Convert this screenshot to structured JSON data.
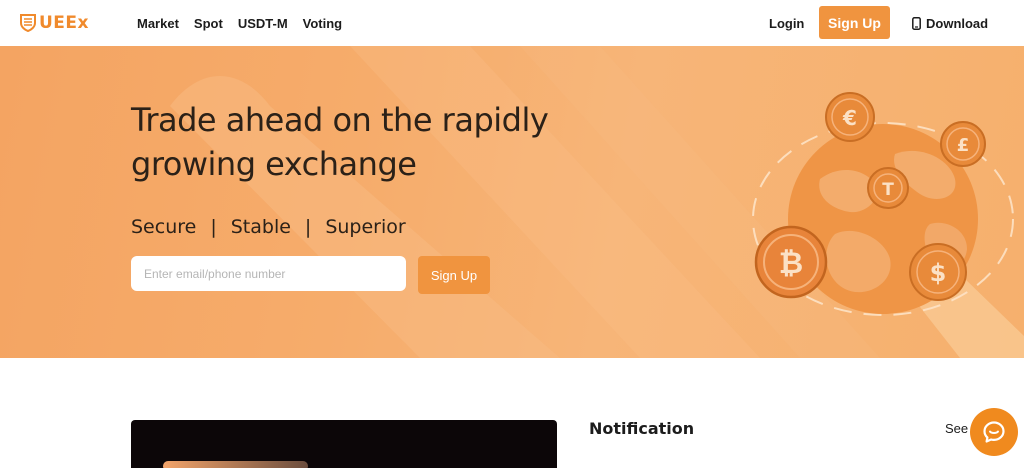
{
  "header": {
    "logo_text": "UEEx",
    "nav": [
      "Market",
      "Spot",
      "USDT-M",
      "Voting"
    ],
    "login": "Login",
    "signup": "Sign Up",
    "download": "Download"
  },
  "hero": {
    "title_line1": "Trade ahead on the rapidly",
    "title_line2": "growing exchange",
    "taglines": [
      "Secure",
      "|",
      "Stable",
      "|",
      "Superior"
    ],
    "input_placeholder": "Enter email/phone number",
    "signup_button": "Sign Up"
  },
  "notification": {
    "title": "Notification",
    "see_all": "See"
  },
  "icons": {
    "coins": [
      "euro-coin-icon",
      "pound-coin-icon",
      "tether-coin-icon",
      "bitcoin-coin-icon",
      "dollar-coin-icon"
    ],
    "chat": "chat-icon",
    "download": "phone-icon"
  },
  "colors": {
    "accent": "#f0943f",
    "hero_bg": "#f6ac6b",
    "logo": "#f08a2c"
  }
}
